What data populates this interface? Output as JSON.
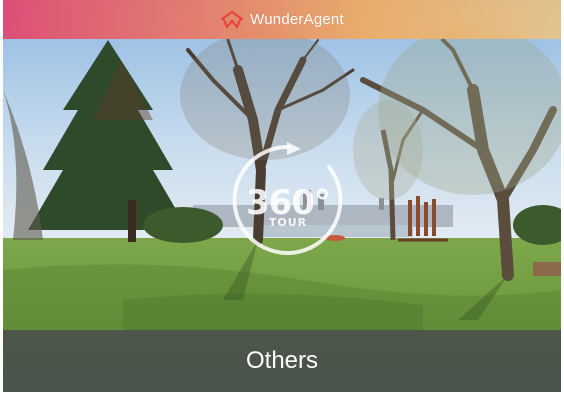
{
  "brand": {
    "name": "WunderAgent",
    "logo_icon": "house-w-logo-icon",
    "logo_color": "#e8453c"
  },
  "tour": {
    "number": "360°",
    "label": "TOUR",
    "icon": "rotate-360-icon"
  },
  "caption": {
    "text": "Others"
  },
  "colors": {
    "header_gradient_start": "#e2466e",
    "header_gradient_end": "#f6c478",
    "caption_bg": "#46484e"
  }
}
